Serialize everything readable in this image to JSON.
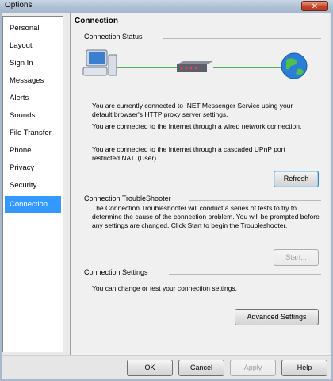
{
  "window": {
    "title": "Options",
    "close_glyph": "✕"
  },
  "sidebar": {
    "items": [
      {
        "label": "Personal"
      },
      {
        "label": "Layout"
      },
      {
        "label": "Sign In"
      },
      {
        "label": "Messages"
      },
      {
        "label": "Alerts"
      },
      {
        "label": "Sounds"
      },
      {
        "label": "File Transfer"
      },
      {
        "label": "Phone"
      },
      {
        "label": "Privacy"
      },
      {
        "label": "Security"
      },
      {
        "label": "Connection",
        "selected": true
      }
    ]
  },
  "panel": {
    "title": "Connection",
    "status": {
      "label": "Connection Status",
      "line1": "You are currently connected to .NET Messenger Service using your default browser's HTTP proxy server settings.",
      "line2": "You are connected to the Internet through a wired network connection.",
      "line3": "You are connected to the Internet through a cascaded UPnP port restricted NAT.  (User)",
      "refresh_label": "Refresh"
    },
    "troubleshooter": {
      "label": "Connection TroubleShooter",
      "text": "The Connection Troubleshooter will conduct a series of tests to try to determine the cause of the connection problem. You will be prompted before any settings are changed. Click Start to begin the Troubleshooter.",
      "start_label": "Start..."
    },
    "settings": {
      "label": "Connection Settings",
      "text": "You can change or test your connection settings.",
      "advanced_label": "Advanced Settings"
    }
  },
  "footer": {
    "ok_label": "OK",
    "cancel_label": "Cancel",
    "apply_label": "Apply",
    "help_label": "Help"
  },
  "colors": {
    "accent": "#3399ff",
    "link_line": "#49b64f"
  }
}
